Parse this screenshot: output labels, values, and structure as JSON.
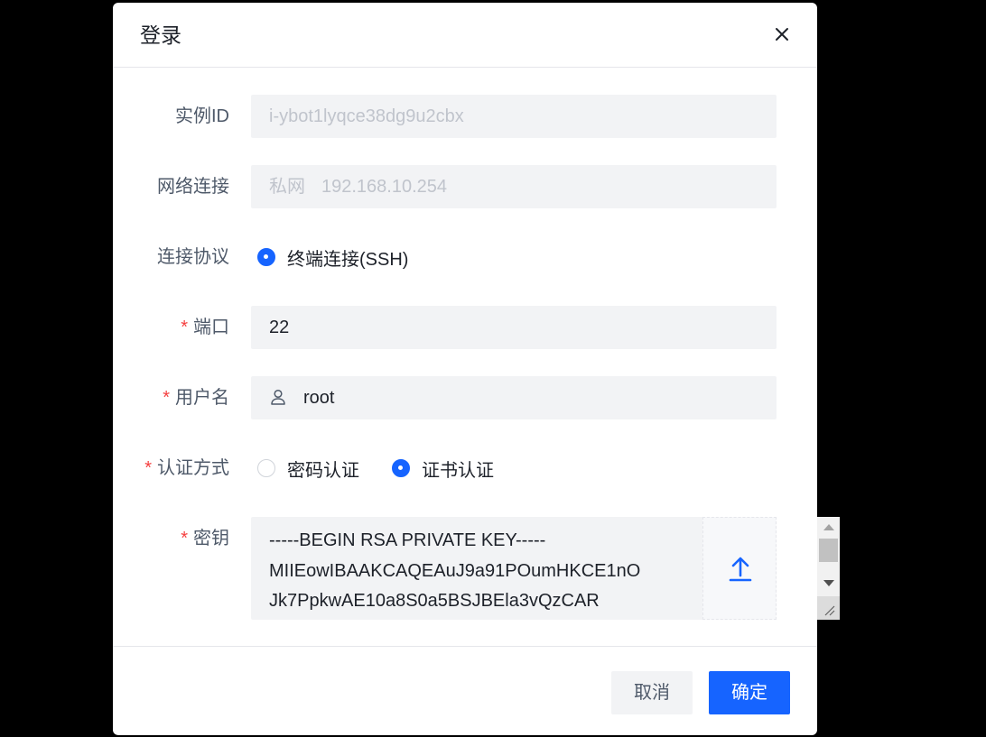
{
  "dialog": {
    "title": "登录",
    "close_icon": "close-icon"
  },
  "form": {
    "instance_id": {
      "label": "实例ID",
      "value": "i-ybot1lyqce38dg9u2cbx"
    },
    "network": {
      "label": "网络连接",
      "type": "私网",
      "ip": "192.168.10.254"
    },
    "protocol": {
      "label": "连接协议",
      "option": "终端连接(SSH)",
      "selected": true
    },
    "port": {
      "label": "端口",
      "required": "*",
      "value": "22"
    },
    "username": {
      "label": "用户名",
      "required": "*",
      "value": "root",
      "icon": "user-icon"
    },
    "auth": {
      "label": "认证方式",
      "required": "*",
      "options": [
        {
          "label": "密码认证",
          "selected": false
        },
        {
          "label": "证书认证",
          "selected": true
        }
      ]
    },
    "key": {
      "label": "密钥",
      "required": "*",
      "lines": [
        "-----BEGIN RSA PRIVATE KEY-----",
        "MIIEowIBAAKCAQEAuJ9a91POumHKCE1nO",
        "Jk7PpkwAE10a8S0a5BSJBEla3vQzCAR"
      ],
      "upload_icon": "upload-icon"
    }
  },
  "footer": {
    "cancel_label": "取消",
    "ok_label": "确定"
  },
  "colors": {
    "primary": "#1664ff",
    "required": "#f53f3f",
    "field_bg": "#f2f3f5"
  }
}
